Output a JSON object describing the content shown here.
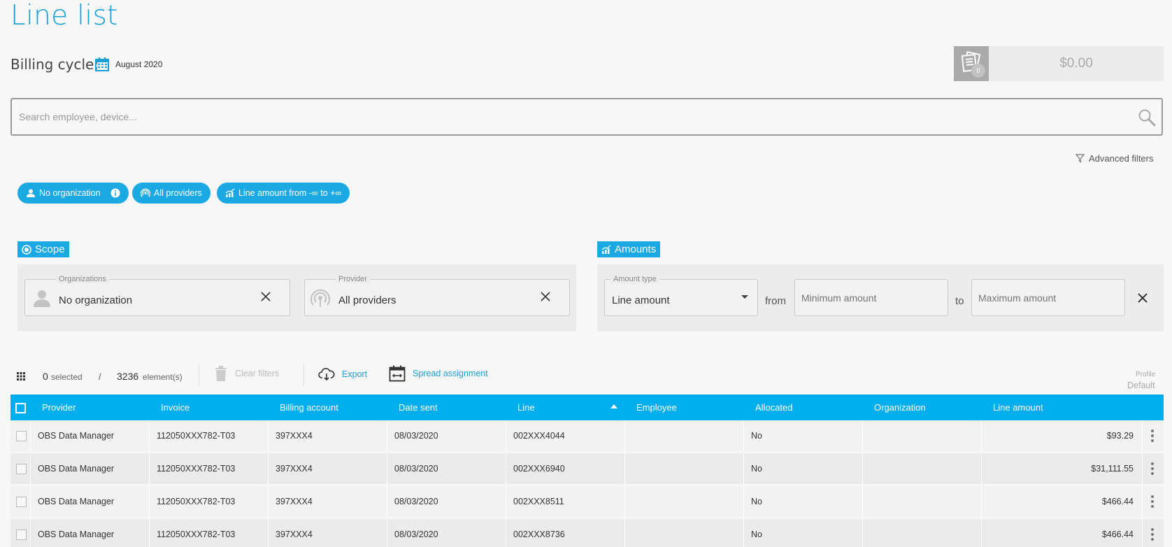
{
  "page": {
    "title": "Line list"
  },
  "billing": {
    "label": "Billing cycle:",
    "value": "August 2020"
  },
  "cart": {
    "count": "0",
    "total": "$0.00"
  },
  "search": {
    "placeholder": "Search employee, device..."
  },
  "advanced_filters": {
    "label": "Advanced filters"
  },
  "chips": [
    {
      "label": "No organization"
    },
    {
      "label": "All providers"
    },
    {
      "label": "Line amount from -∞ to +∞"
    }
  ],
  "scope": {
    "title": "Scope",
    "organizations": {
      "legend": "Organizations",
      "value": "No organization"
    },
    "provider": {
      "legend": "Provider",
      "value": "All providers"
    }
  },
  "amounts": {
    "title": "Amounts",
    "amount_type": {
      "legend": "Amount type",
      "value": "Line amount"
    },
    "from_label": "from",
    "to_label": "to",
    "min_placeholder": "Minimum amount",
    "max_placeholder": "Maximum amount"
  },
  "toolbar": {
    "selected_count": "0",
    "selected_label": "selected",
    "separator": "/",
    "element_count": "3236",
    "element_label": "element(s)",
    "clear_filters": "Clear filters",
    "export": "Export",
    "spread_assignment": "Spread assignment",
    "profile_label": "Profile",
    "profile_value": "Default"
  },
  "columns": [
    "Provider",
    "Invoice",
    "Billing account",
    "Date sent",
    "Line",
    "Employee",
    "Allocated",
    "Organization",
    "Line amount"
  ],
  "rows": [
    {
      "provider": "OBS Data Manager",
      "invoice": "112050XXX782-T03",
      "billing_account": "397XXX4",
      "date_sent": "08/03/2020",
      "line": "002XXX4044",
      "employee": "",
      "allocated": "No",
      "organization": "",
      "amount": "$93.29"
    },
    {
      "provider": "OBS Data Manager",
      "invoice": "112050XXX782-T03",
      "billing_account": "397XXX4",
      "date_sent": "08/03/2020",
      "line": "002XXX6940",
      "employee": "",
      "allocated": "No",
      "organization": "",
      "amount": "$31,111.55"
    },
    {
      "provider": "OBS Data Manager",
      "invoice": "112050XXX782-T03",
      "billing_account": "397XXX4",
      "date_sent": "08/03/2020",
      "line": "002XXX8511",
      "employee": "",
      "allocated": "No",
      "organization": "",
      "amount": "$466.44"
    },
    {
      "provider": "OBS Data Manager",
      "invoice": "112050XXX782-T03",
      "billing_account": "397XXX4",
      "date_sent": "08/03/2020",
      "line": "002XXX8736",
      "employee": "",
      "allocated": "No",
      "organization": "",
      "amount": "$466.44"
    }
  ],
  "colors": {
    "accent": "#1aa9e3",
    "header": "#00aeef"
  }
}
